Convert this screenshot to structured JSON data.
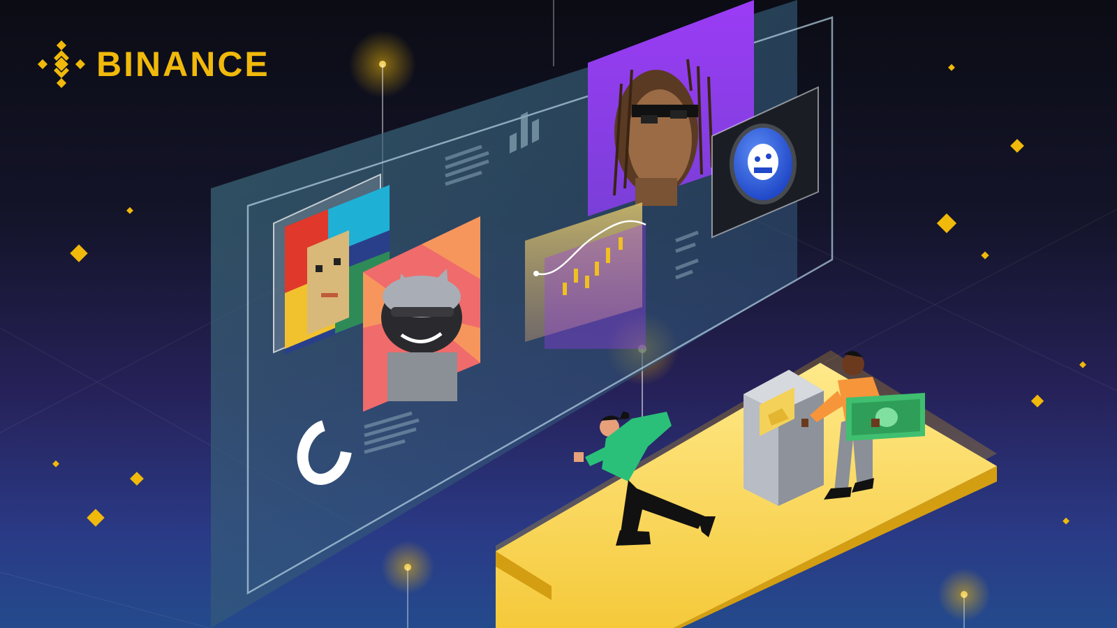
{
  "brand": {
    "name": "BINANCE",
    "logo_icon": "binance-diamond-logo-icon",
    "color": "#F0B90B"
  },
  "scene": {
    "background_colors": [
      "#0B0C14",
      "#262158",
      "#244A8C"
    ],
    "accent_color": "#F0B90B",
    "nft_cards": [
      "pixel-punk-nft",
      "robot-cat-nft",
      "braided-avatar-nft",
      "ape-coin-badge"
    ],
    "figures": [
      "running-person",
      "person-with-cash",
      "atm-kiosk"
    ],
    "platform_color": "#F5CE45"
  }
}
